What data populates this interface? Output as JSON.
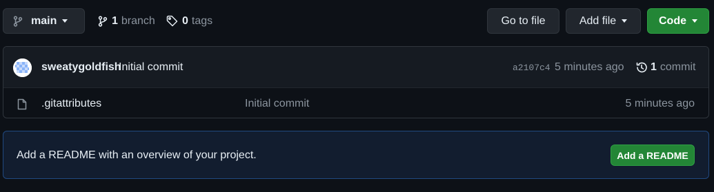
{
  "toolbar": {
    "branch_button": "main",
    "branches_count": "1",
    "branches_label": "branch",
    "tags_count": "0",
    "tags_label": "tags",
    "go_to_file": "Go to file",
    "add_file": "Add file",
    "code": "Code"
  },
  "latest_commit": {
    "author": "sweatygoldfish",
    "message": "Initial commit",
    "sha": "a2107c4",
    "time": "5 minutes ago",
    "commit_count": "1",
    "commit_label": "commit"
  },
  "files": [
    {
      "name": ".gitattributes",
      "message": "Initial commit",
      "time": "5 minutes ago",
      "icon": "file-icon"
    }
  ],
  "readme_prompt": {
    "text": "Add a README with an overview of your project.",
    "button": "Add a README"
  },
  "colors": {
    "background": "#0d1117",
    "primary_button": "#238636",
    "readme_banner": "#121d2f"
  }
}
